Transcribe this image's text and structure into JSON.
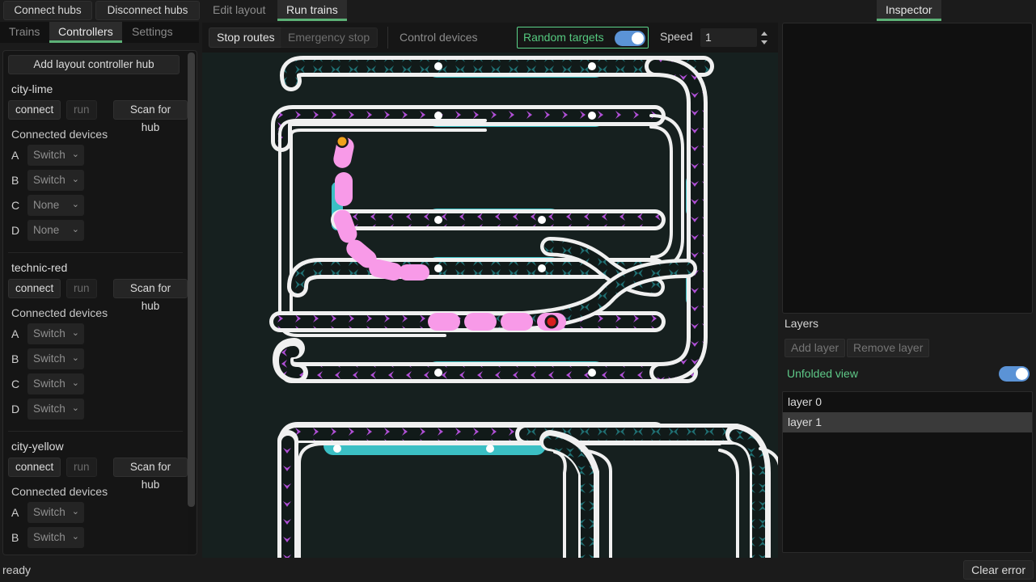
{
  "toolbar": {
    "connect_hubs": "Connect hubs",
    "disconnect_hubs": "Disconnect hubs"
  },
  "top_tabs": [
    {
      "label": "Edit layout",
      "active": false,
      "enabled": false
    },
    {
      "label": "Run trains",
      "active": true,
      "enabled": true
    }
  ],
  "inspector_tab": {
    "label": "Inspector",
    "active": true
  },
  "left_subtabs": [
    {
      "label": "Trains",
      "active": false
    },
    {
      "label": "Controllers",
      "active": true
    },
    {
      "label": "Settings",
      "active": false
    }
  ],
  "controllers": {
    "add_hub_label": "Add layout controller hub",
    "connect_label": "connect",
    "run_label": "run",
    "scan_label": "Scan for hub",
    "devices_header": "Connected devices",
    "hubs": [
      {
        "name": "city-lime",
        "ports": [
          {
            "letter": "A",
            "value": "Switch"
          },
          {
            "letter": "B",
            "value": "Switch"
          },
          {
            "letter": "C",
            "value": "None"
          },
          {
            "letter": "D",
            "value": "None"
          }
        ]
      },
      {
        "name": "technic-red",
        "ports": [
          {
            "letter": "A",
            "value": "Switch"
          },
          {
            "letter": "B",
            "value": "Switch"
          },
          {
            "letter": "C",
            "value": "Switch"
          },
          {
            "letter": "D",
            "value": "Switch"
          }
        ]
      },
      {
        "name": "city-yellow",
        "ports": [
          {
            "letter": "A",
            "value": "Switch"
          },
          {
            "letter": "B",
            "value": "Switch"
          }
        ]
      }
    ]
  },
  "canvas_toolbar": {
    "stop_routes": "Stop routes",
    "emergency_stop": "Emergency stop",
    "control_devices": "Control devices",
    "random_targets_label": "Random targets",
    "random_targets_on": true,
    "speed_label": "Speed",
    "speed_value": "1"
  },
  "layers": {
    "title": "Layers",
    "add_label": "Add layer",
    "remove_label": "Remove layer",
    "unfolded_label": "Unfolded view",
    "unfolded_on": true,
    "items": [
      {
        "label": "layer 0",
        "selected": false
      },
      {
        "label": "layer 1",
        "selected": true
      }
    ]
  },
  "status": {
    "message": "ready",
    "clear_error_label": "Clear error"
  },
  "colors": {
    "accent_green": "#5cb176",
    "toggle_blue": "#5b93d6",
    "canvas_bg": "#16201f",
    "track_outline": "#f0f0f0",
    "block_cyan": "#3bbfc4",
    "marker_teal": "#1f6f72",
    "marker_purple": "#b04fd6",
    "train_pink": "#f89ae8",
    "sensor_white": "#ffffff",
    "target_orange": "#f0a21a",
    "target_red": "#d81f1f"
  }
}
